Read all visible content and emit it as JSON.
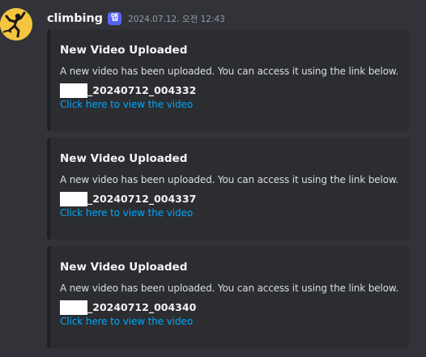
{
  "message": {
    "username": "climbing",
    "app_badge": "앱",
    "timestamp": "2024.07.12. 오전 12:43",
    "avatar_icon": "climber-icon",
    "colors": {
      "background": "#313338",
      "embed_background": "#2b2d31",
      "link": "#00a8fc",
      "badge": "#5865f2",
      "avatar": "#f5c542"
    }
  },
  "embeds": [
    {
      "title": "New Video Uploaded",
      "description": "A new video has been uploaded. You can access it using the link below.",
      "filename": "_20240712_004332",
      "link_text": "Click here to view the video"
    },
    {
      "title": "New Video Uploaded",
      "description": "A new video has been uploaded. You can access it using the link below.",
      "filename": "_20240712_004337",
      "link_text": "Click here to view the video"
    },
    {
      "title": "New Video Uploaded",
      "description": "A new video has been uploaded. You can access it using the link below.",
      "filename": "_20240712_004340",
      "link_text": "Click here to view the video"
    }
  ]
}
